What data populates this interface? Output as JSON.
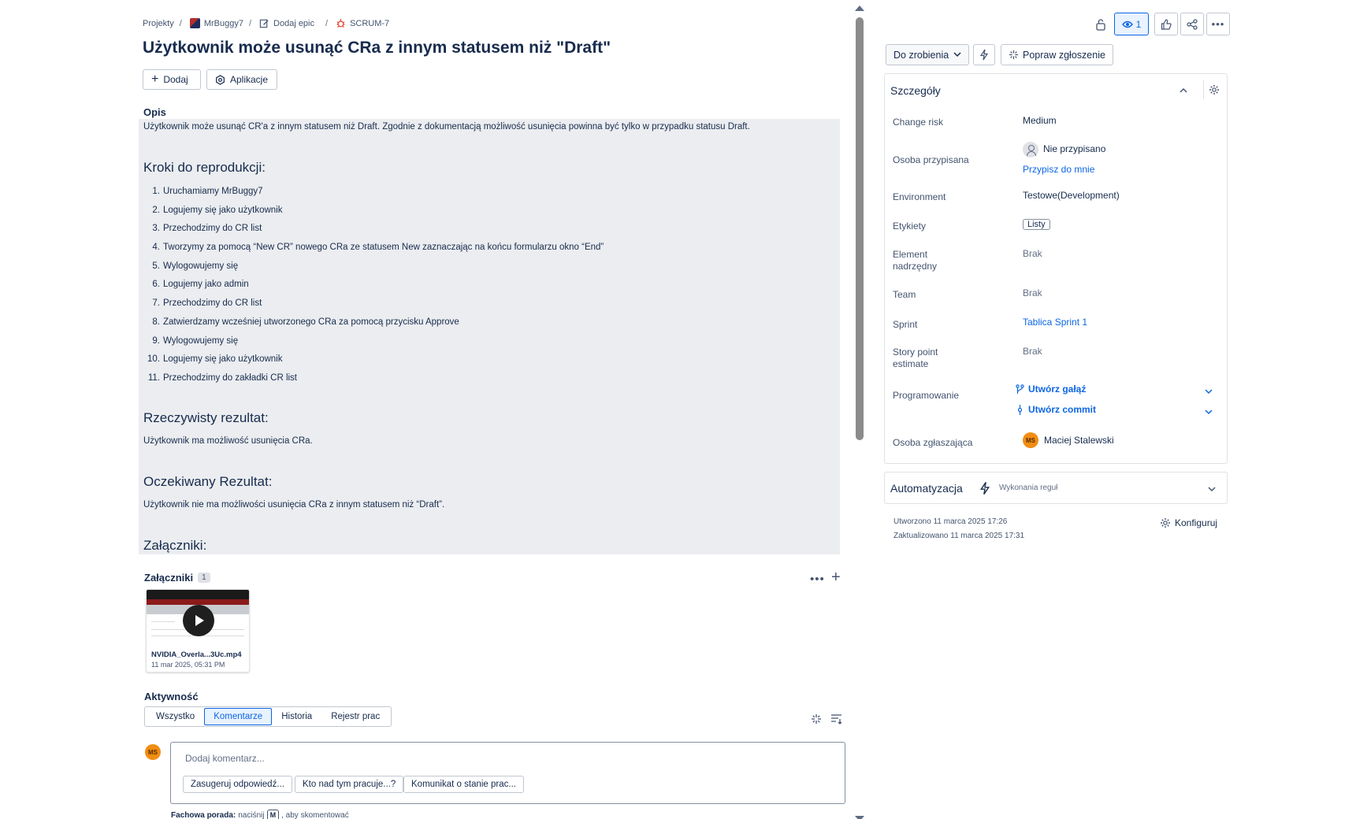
{
  "breadcrumb": {
    "projects": "Projekty",
    "project": "MrBuggy7",
    "add_epic": "Dodaj epic",
    "issue_key": "SCRUM-7"
  },
  "issue": {
    "title": "Użytkownik może usunąć CRa z innym statusem niż \"Draft\"",
    "add_label": "Dodaj",
    "apps_label": "Aplikacje"
  },
  "description": {
    "label": "Opis",
    "text": "Użytkownik może usunąć CR'a z innym statusem niż Draft. Zgodnie z dokumentacją możliwość usunięcia powinna być tylko w przypadku statusu Draft.",
    "steps_heading": "Kroki do reprodukcji:",
    "steps": [
      {
        "n": "1.",
        "text": "Uruchamiamy MrBuggy7"
      },
      {
        "n": "2.",
        "text": "Logujemy się jako użytkownik"
      },
      {
        "n": "3.",
        "text": "Przechodzimy do CR list"
      },
      {
        "n": "4.",
        "text": "Tworzymy za pomocą “New CR” nowego CRa ze statusem New zaznaczając na końcu formularzu okno  “End”"
      },
      {
        "n": "5.",
        "text": "Wylogowujemy się"
      },
      {
        "n": "6.",
        "text": "Logujemy jako admin"
      },
      {
        "n": "7.",
        "text": "Przechodzimy do CR list"
      },
      {
        "n": "8.",
        "text": "Zatwierdzamy wcześniej utworzonego CRa za pomocą przycisku Approve"
      },
      {
        "n": "9.",
        "text": "Wylogowujemy się"
      },
      {
        "n": "10.",
        "text": "Logujemy się jako użytkownik"
      },
      {
        "n": "11.",
        "text": "Przechodzimy do zakładki CR list"
      }
    ],
    "actual_heading": "Rzeczywisty rezultat:",
    "actual_text": "Użytkownik ma możliwość usunięcia CRa.",
    "expected_heading": "Oczekiwany Rezultat:",
    "expected_text": "Użytkownik nie ma możliwości usunięcia CRa z innym statusem niż “Draft”.",
    "attachments_heading": "Załączniki:"
  },
  "attachments": {
    "label": "Załączniki",
    "count": "1",
    "file_name": "NVIDIA_Overla...3Uc.mp4",
    "file_date": "11 mar 2025, 05:31 PM"
  },
  "activity": {
    "label": "Aktywność",
    "tabs": [
      "Wszystko",
      "Komentarze",
      "Historia",
      "Rejestr prac"
    ],
    "active_tab": "Komentarze",
    "comment_placeholder": "Dodaj komentarz...",
    "suggestions": [
      "Zasugeruj odpowiedź...",
      "Kto nad tym pracuje...?",
      "Komunikat o stanie prac..."
    ],
    "avatar_initials": "MS",
    "tip_bold": "Fachowa porada:",
    "tip_pre": "naciśnij",
    "tip_key": "M",
    "tip_post": ", aby skomentować"
  },
  "toolbar": {
    "watchers_count": "1",
    "status": "Do zrobienia",
    "improve": "Popraw zgłoszenie"
  },
  "details": {
    "heading": "Szczegóły",
    "change_risk_label": "Change risk",
    "change_risk": "Medium",
    "assignee_label": "Osoba przypisana",
    "assignee": "Nie przypisano",
    "assign_to_me": "Przypisz do mnie",
    "environment_label": "Environment",
    "environment": "Testowe(Development)",
    "labels_label": "Etykiety",
    "label_tag": "Listy",
    "parent_label_1": "Element",
    "parent_label_2": "nadrzędny",
    "parent": "Brak",
    "team_label": "Team",
    "team": "Brak",
    "sprint_label": "Sprint",
    "sprint": "Tablica Sprint 1",
    "story_label_1": "Story point",
    "story_label_2": "estimate",
    "story": "Brak",
    "dev_label": "Programowanie",
    "create_branch": "Utwórz gałąź",
    "create_commit": "Utwórz commit",
    "reporter_label": "Osoba zgłaszająca",
    "reporter": "Maciej Stalewski",
    "reporter_initials": "MS"
  },
  "automation": {
    "title": "Automatyzacja",
    "subtitle": "Wykonania reguł"
  },
  "meta": {
    "created": "Utworzono 11 marca 2025 17:26",
    "updated": "Zaktualizowano 11 marca 2025 17:31",
    "configure": "Konfiguruj"
  },
  "colors": {
    "accent": "#0c66e4",
    "description_bg": "#ebedf0",
    "avatar": "#f18d13"
  }
}
